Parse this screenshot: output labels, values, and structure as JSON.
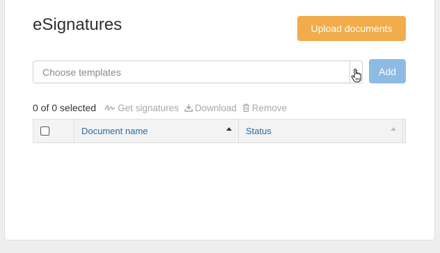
{
  "page": {
    "title": "eSignatures"
  },
  "actions": {
    "upload_label": "Upload documents",
    "add_label": "Add"
  },
  "template_select": {
    "placeholder": "Choose templates"
  },
  "toolbar": {
    "selection_count": "0 of 0 selected",
    "get_signatures_label": "Get signatures",
    "download_label": "Download",
    "remove_label": "Remove"
  },
  "table": {
    "columns": [
      {
        "label": "Document name",
        "sort": "ascending"
      },
      {
        "label": "Status",
        "sort": "none"
      }
    ]
  },
  "colors": {
    "upload_button": "#f2ac4c",
    "add_button": "#8dbbe4",
    "column_header_text": "#2b6aa0",
    "disabled_tool_text": "#a8a8a8"
  },
  "icons": [
    "signature-icon",
    "download-icon",
    "trash-icon",
    "hand-pointer-icon",
    "sort-ascending-icon"
  ]
}
